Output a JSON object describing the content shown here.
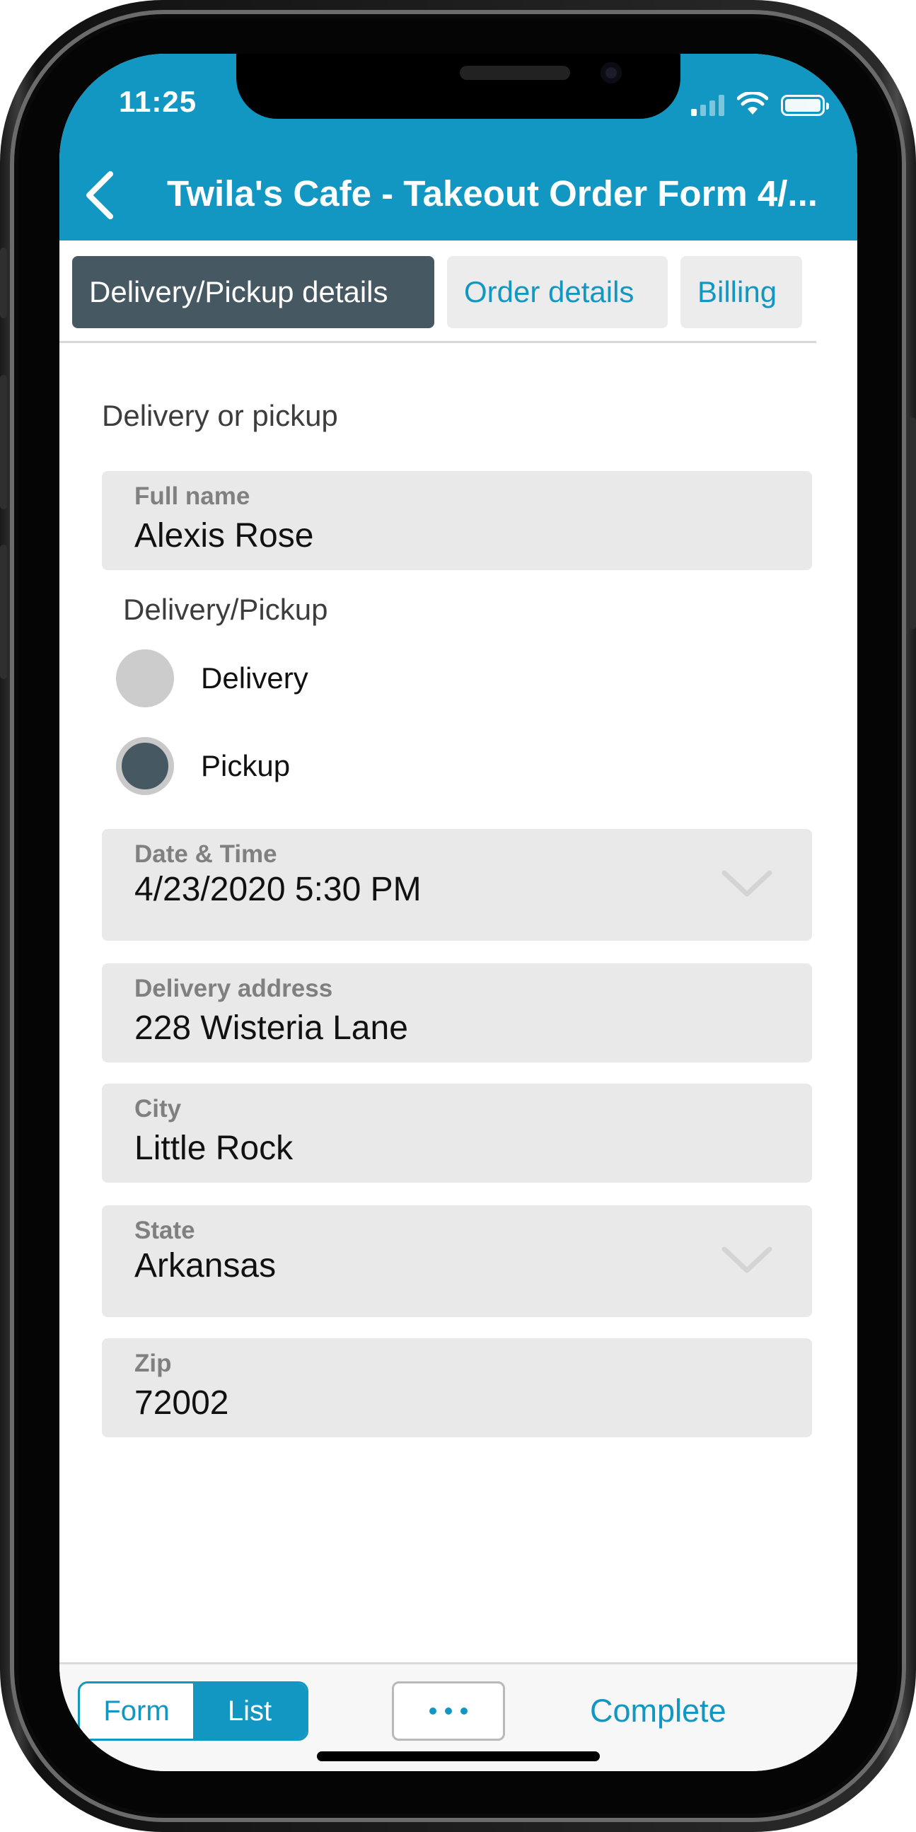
{
  "status_bar": {
    "time": "11:25"
  },
  "header": {
    "back_icon": "chevron-left-icon",
    "title": "Twila's Cafe - Takeout Order Form 4/..."
  },
  "tabs": [
    {
      "label": "Delivery/Pickup details",
      "active": true
    },
    {
      "label": "Order details",
      "active": false
    },
    {
      "label": "Billing",
      "active": false
    }
  ],
  "form": {
    "section_title": "Delivery or pickup",
    "full_name": {
      "label": "Full name",
      "value": "Alexis Rose"
    },
    "delivery_pickup": {
      "label": "Delivery/Pickup",
      "options": [
        {
          "label": "Delivery",
          "selected": false
        },
        {
          "label": "Pickup",
          "selected": true
        }
      ]
    },
    "date_time": {
      "label": "Date & Time",
      "value": "4/23/2020 5:30 PM"
    },
    "delivery_address": {
      "label": "Delivery address",
      "value": "228 Wisteria Lane"
    },
    "city": {
      "label": "City",
      "value": "Little Rock"
    },
    "state": {
      "label": "State",
      "value": "Arkansas"
    },
    "zip": {
      "label": "Zip",
      "value": "72002"
    }
  },
  "toolbar": {
    "form_label": "Form",
    "list_label": "List",
    "active_view": "List",
    "more_icon": "ellipsis-icon",
    "complete_label": "Complete"
  },
  "colors": {
    "accent": "#1197c2",
    "active_tab": "#465862",
    "field_bg": "#e9e9e9"
  }
}
